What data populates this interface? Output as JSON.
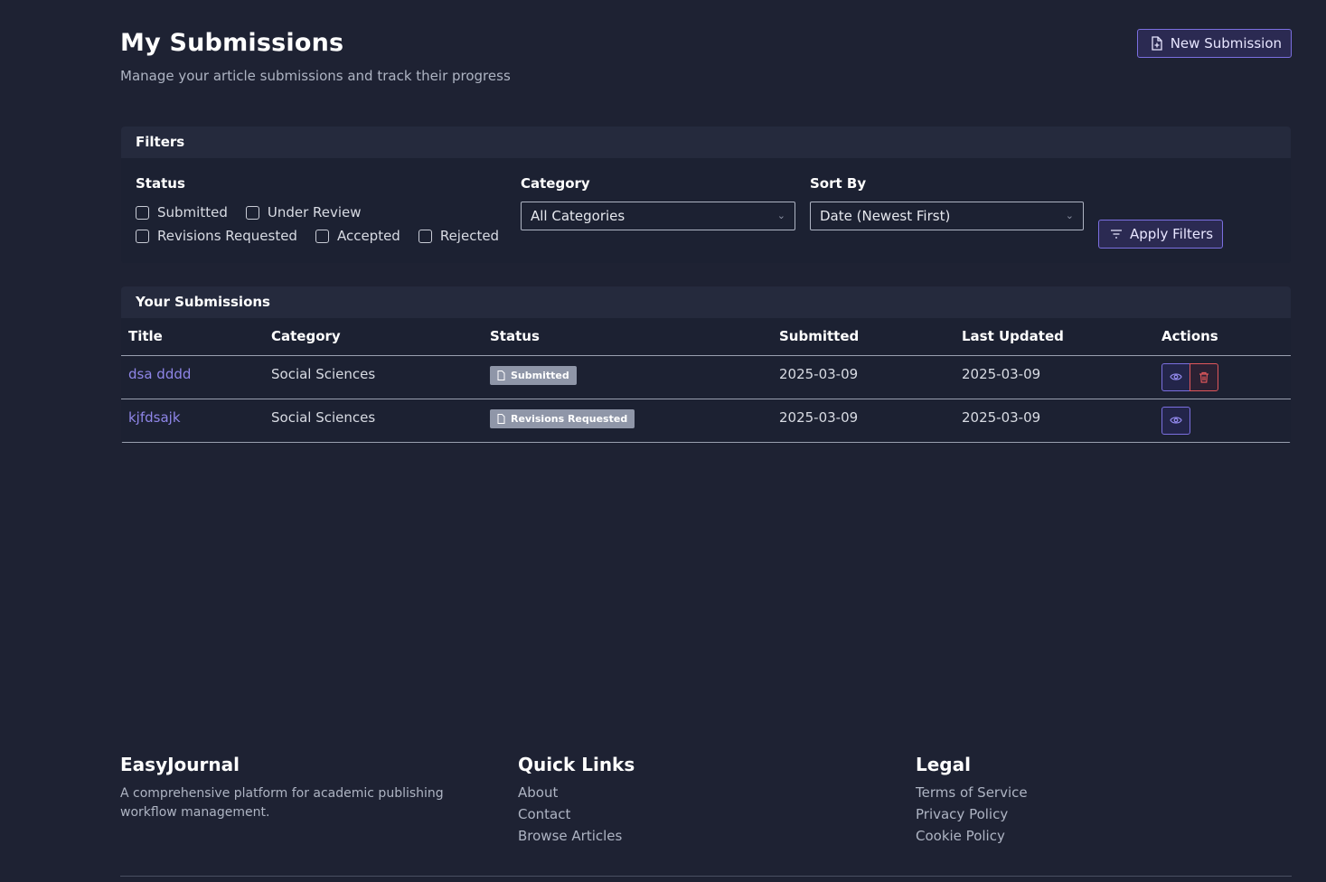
{
  "header": {
    "title": "My Submissions",
    "subtitle": "Manage your article submissions and track their progress",
    "new_submission_label": "New Submission",
    "new_submission_icon": "file-plus-icon"
  },
  "filters": {
    "title": "Filters",
    "status_label": "Status",
    "statuses": [
      "Submitted",
      "Under Review",
      "Revisions Requested",
      "Accepted",
      "Rejected"
    ],
    "category_label": "Category",
    "category_value": "All Categories",
    "sort_label": "Sort By",
    "sort_value": "Date (Newest First)",
    "apply_label": "Apply Filters",
    "apply_icon": "filter-icon"
  },
  "submissions": {
    "title": "Your Submissions",
    "columns": [
      "Title",
      "Category",
      "Status",
      "Submitted",
      "Last Updated",
      "Actions"
    ],
    "rows": [
      {
        "title": "dsa dddd",
        "category": "Social Sciences",
        "status": "Submitted",
        "submitted": "2025-03-09",
        "updated": "2025-03-09",
        "actions": [
          "eye-icon",
          "trash-icon"
        ]
      },
      {
        "title": "kjfdsajk",
        "category": "Social Sciences",
        "status": "Revisions Requested",
        "submitted": "2025-03-09",
        "updated": "2025-03-09",
        "actions": [
          "eye-icon"
        ]
      }
    ]
  },
  "footer": {
    "brand": "EasyJournal",
    "description": "A comprehensive platform for academic publishing workflow management.",
    "quick_links_title": "Quick Links",
    "quick_links": [
      "About",
      "Contact",
      "Browse Articles"
    ],
    "legal_title": "Legal",
    "legal_links": [
      "Terms of Service",
      "Privacy Policy",
      "Cookie Policy"
    ]
  },
  "colors": {
    "background": "#1e2233",
    "accent": "#7b6fe0",
    "link": "#8f86e8",
    "danger": "#e0575b",
    "badge": "#8f96a8"
  }
}
